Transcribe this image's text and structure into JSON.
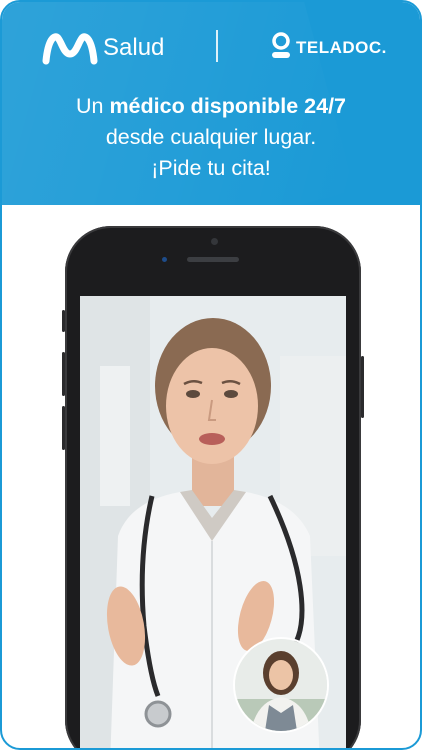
{
  "header": {
    "brand_name": "Salud",
    "partner_name": "TELADOC.",
    "headline_prefix": "Un ",
    "headline_bold": "médico disponible 24/7",
    "headline_line2": "desde cualquier lugar.",
    "headline_line3": "¡Pide tu cita!"
  },
  "colors": {
    "brand_blue": "#1b9ad6",
    "text_white": "#ffffff"
  },
  "icons": [
    "movistar-logo-icon",
    "teladoc-logo-icon"
  ]
}
